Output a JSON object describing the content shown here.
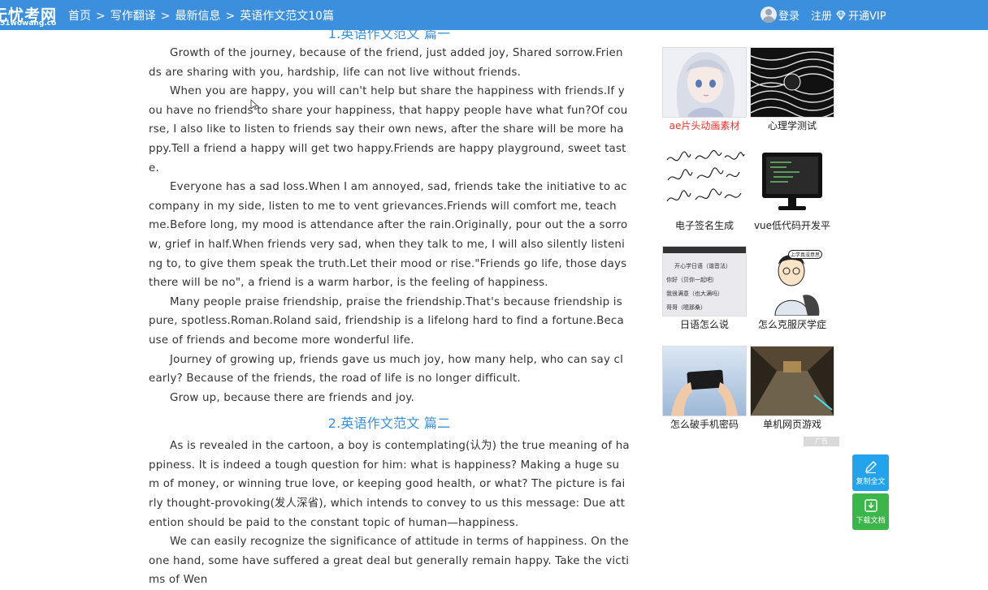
{
  "header": {
    "logo_main": "无忧考网",
    "logo_sub": "51wowang.com",
    "breadcrumb": [
      "首页",
      "写作翻译",
      "最新信息",
      "英语作文范文10篇"
    ],
    "breadcrumb_sep": ">",
    "login": "登录",
    "register": "注册",
    "vip": "开通VIP"
  },
  "article": {
    "section1_title": "1.英语作文范文 篇一",
    "section1_paragraphs": [
      "Growth of the journey, because of the friend, just added joy, Shared sorrow.Friends are sharing with you, hardship, life can not live without friends.",
      "When you are happy, you will can't help but share the happiness with friends.If you have no friends to share your happiness, that happy people have what fun?Of course, I also like to listen to friends say their own news, after the share will be more happy.Tell a friend a happy will get two happy.Friends are happy playground, sweet taste.",
      "Everyone has a sad loss.When I am annoyed, sad, friends take the initiative to accompany in my side, listen to me to vent grievances.Friends will comfort me, teach me.Before long, my mood is attendance after the rain.Originally, pour out the a sorrow, grief in half.When friends very sad, when they talk to me, I will also silently listening to, to give them speak the truth.Let their mood or rise.\"Friends go life, those days there will be no\", a friend is a warm harbor, is the feeling of happiness.",
      "Many people praise friendship, praise the friendship.That's because friendship is pure, spotless.Roman.Roland said, friendship is a lifelong hard to find a fortune.Because of friends and become more wonderful life.",
      "Journey of growing up, friends gave us much joy, how many help, who can say clearly? Because of the friends, the road of life is no longer difficult.",
      "Grow up, because there are friends and joy."
    ],
    "section2_title": "2.英语作文范文 篇二",
    "section2_paragraphs": [
      "As is revealed in the cartoon, a boy is contemplating(认为) the true meaning of happiness. It is indeed a tough question for him: what is happiness? Making a huge sum of money, or winning true love, or keeping good health, or what? The picture is fairly thought-provoking(发人深省), which intends to convey to us this message: Due attention should be paid to the constant topic of human—happiness.",
      "We can easily recognize the significance of attitude in terms of happiness. On the one hand, some have suffered a great deal but generally remain happy. Take the victims of Wen"
    ]
  },
  "sidebar": {
    "tiles": [
      {
        "caption": "ae片头动画素材",
        "highlight": true
      },
      {
        "caption": "心理学测试",
        "highlight": false
      },
      {
        "caption": "电子签名生成",
        "highlight": false
      },
      {
        "caption": "vue低代码开发平",
        "highlight": false
      },
      {
        "caption": "日语怎么说",
        "highlight": false
      },
      {
        "caption": "怎么克服厌学症",
        "highlight": false
      },
      {
        "caption": "怎么破手机密码",
        "highlight": false
      },
      {
        "caption": "单机网页游戏",
        "highlight": false
      }
    ],
    "ad_tag": "广告",
    "japanese_lines": [
      "开心学日语（谐音法）",
      "你好（贝你一起吧）",
      "我很满意（也大满吗）",
      "哥哥（嗯那桑）"
    ],
    "speech_bubble": "上学真没意思"
  },
  "actions": {
    "copy_label": "复制全文",
    "download_label": "下载文档"
  },
  "colors": {
    "brand_blue": "#3b8fdc",
    "title_blue": "#3b8fdc",
    "highlight_red": "#e8332c",
    "copy_btn": "#22a3ec",
    "download_btn": "#3cb54a"
  }
}
